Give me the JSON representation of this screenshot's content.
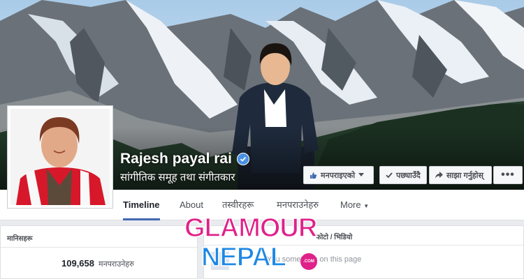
{
  "cover": {
    "sky_color": "#b9d6ee",
    "snow_color": "#f2f5f8",
    "rock_color": "#5d6369",
    "forest_color": "#203626"
  },
  "profile": {
    "name": "Rajesh payal rai",
    "verified": true,
    "category": "सांगीतिक समूह तथा संगीतकार"
  },
  "actions": {
    "like_label": "मनपराइएको",
    "follow_label": "पछ्याउँदै",
    "share_label": "साझा गर्नुहोस्",
    "more_label": "•••"
  },
  "nav": {
    "tabs": [
      {
        "label": "Timeline",
        "active": true
      },
      {
        "label": "About"
      },
      {
        "label": "तस्वीरहरू"
      },
      {
        "label": "मनपराउनेहरु"
      },
      {
        "label": "More"
      }
    ]
  },
  "sidebar_card": {
    "title": "मानिसहरू",
    "likes_count": "109,658",
    "likes_label": "मनपराउनेहरु"
  },
  "composer": {
    "post_type": "फोटो / भिडियो",
    "placeholder": "You something on this page"
  },
  "watermark": {
    "line1": "GLAMOUR",
    "line2": "NEPAL",
    "suffix": ".COM"
  },
  "colors": {
    "accent": "#4267b2",
    "verified": "#4a90e2",
    "watermark_pink": "#e0218a",
    "watermark_blue": "#1e88e5"
  }
}
